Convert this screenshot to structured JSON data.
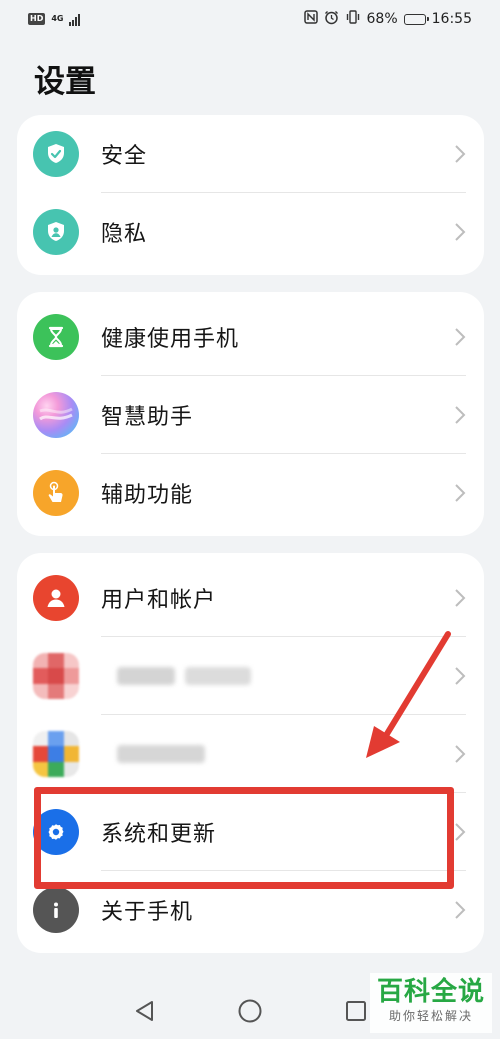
{
  "status_bar": {
    "hd": "HD",
    "network": "4G",
    "battery_level": "68%",
    "battery_fraction": 0.68,
    "time": "16:55"
  },
  "page": {
    "title": "设置"
  },
  "groups": [
    {
      "items": [
        {
          "label": "安全",
          "icon": "shield-check-icon",
          "color": "#47c4b0"
        },
        {
          "label": "隐私",
          "icon": "privacy-shield-user-icon",
          "color": "#47c4b0"
        }
      ]
    },
    {
      "items": [
        {
          "label": "健康使用手机",
          "icon": "hourglass-icon",
          "color": "#3cc25a"
        },
        {
          "label": "智慧助手",
          "icon": "smart-assistant-icon",
          "color": "#9b7cf2"
        },
        {
          "label": "辅助功能",
          "icon": "touch-hand-icon",
          "color": "#f7a52a"
        }
      ]
    },
    {
      "items": [
        {
          "label": "用户和帐户",
          "icon": "user-account-icon",
          "color": "#e8452f"
        },
        {
          "label": "",
          "icon": "blurred-app-icon",
          "color": "#e07a7a"
        },
        {
          "label": "",
          "icon": "blurred-app-icon",
          "color": "#4a86e8"
        },
        {
          "label": "系统和更新",
          "icon": "gear-icon",
          "color": "#1a6fe8"
        },
        {
          "label": "关于手机",
          "icon": "info-icon",
          "color": "#555555"
        }
      ]
    }
  ],
  "annotation": {
    "color": "#e23b32",
    "highlighted_item": "系统和更新"
  },
  "nav_bar": {
    "buttons": [
      "back-icon",
      "home-icon",
      "recents-icon"
    ]
  },
  "watermark": {
    "title": "百科全说",
    "subtitle": "助你轻松解决",
    "color": "#27a844"
  }
}
